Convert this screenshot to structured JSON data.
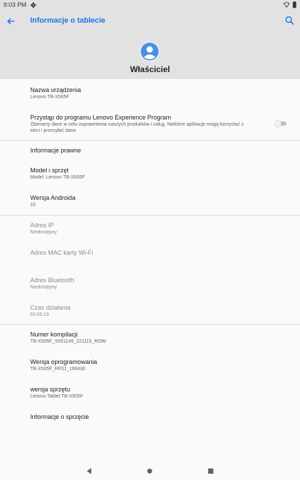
{
  "status_bar": {
    "time": "9:03 PM",
    "icons": [
      "gear-icon",
      "wifi-icon",
      "battery-icon"
    ]
  },
  "toolbar": {
    "title": "Informacje o tablecie",
    "back_icon": "arrow-back-icon",
    "search_icon": "search-icon",
    "accent_color": "#1a73e8"
  },
  "header": {
    "owner_label": "Właściciel",
    "avatar_icon": "account-circle-icon"
  },
  "items": [
    {
      "title": "Nazwa urządzenia",
      "subtitle": "Lenovo TB-X505F"
    },
    {
      "title": "Przystąp do programu Lenovo Experience Program",
      "subtitle": "Zbieramy dane w celu usprawnienia naszych produktów i usług. Niektóre aplikacje mogą korzystać z",
      "subtitle2": "sieci i przesyłać dane."
    },
    {
      "title": "Informacje prawne"
    },
    {
      "title": "Model i sprzęt",
      "subtitle": "Model: Lenovo TB-X505F"
    },
    {
      "title": "Wersja Androida",
      "subtitle": "10"
    },
    {
      "title": "Adres IP",
      "subtitle": "Niedostępny"
    },
    {
      "title": "Adres MAC karty Wi-Fi"
    },
    {
      "title": "Adres Bluetooth",
      "subtitle": "Niedostępny"
    },
    {
      "title": "Czas działania",
      "subtitle": "93:05:16"
    },
    {
      "title": "Numer kompilacji",
      "subtitle": "TB-X505F_S001149_221115_ROW"
    },
    {
      "title": "Wersja oprogramowania",
      "subtitle": "TB-X505F_RF01_190430"
    },
    {
      "title": "wersja sprzętu",
      "subtitle": "Lenovo Tablet TB-X505F"
    },
    {
      "title": "Informacje o sprzęcie"
    }
  ],
  "experience_toggle": {
    "on": false
  },
  "navbar": {
    "icons": [
      "back-triangle-icon",
      "home-circle-icon",
      "recents-square-icon"
    ]
  }
}
